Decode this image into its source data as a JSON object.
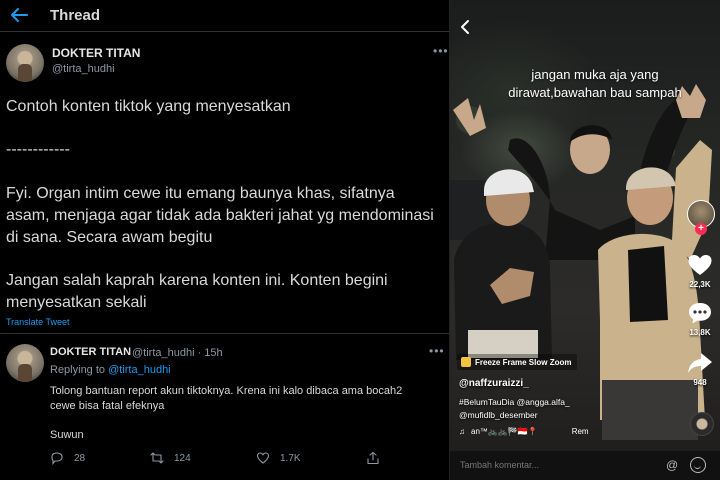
{
  "twitter": {
    "header_title": "Thread",
    "tweet1": {
      "name": "DOKTER TITAN",
      "handle": "@tirta_hudhi",
      "line1": "Contoh konten tiktok yang menyesatkan",
      "dashes": "------------",
      "para1": "Fyi. Organ intim cewe itu emang baunya khas, sifatnya asam,  menjaga agar tidak ada bakteri jahat yg mendominasi di sana. Secara awam begitu",
      "para2": "Jangan salah kaprah karena konten ini. Konten begini menyesatkan sekali",
      "translate": "Translate Tweet"
    },
    "tweet2": {
      "name": "DOKTER TITAN",
      "meta": "@tirta_hudhi · 15h",
      "replying_prefix": "Replying to ",
      "replying_handle": "@tirta_hudhi",
      "text": "Tolong bantuan report akun tiktoknya. Krena ini kalo dibaca ama bocah2 cewe bisa fatal efeknya",
      "closing": "Suwun",
      "replies": "28",
      "retweets": "124",
      "likes": "1.7K"
    }
  },
  "tiktok": {
    "caption": "jangan muka aja yang dirawat,bawahan bau sampah",
    "likes": "22,3K",
    "comments": "13,8K",
    "shares": "948",
    "effect": "Freeze Frame Slow Zoom",
    "username": "@naffzuraizzi_",
    "description": "#BelumTauDia @angga.alfa_ @mufidlb_desember",
    "music": "an™🚲🚲🏁🇮🇩📍",
    "music_right": "Rem",
    "comment_placeholder": "Tambah komentar..."
  },
  "icons": {
    "back": "arrow-left-icon",
    "more": "more-icon",
    "reply": "reply-icon",
    "retweet": "retweet-icon",
    "like": "heart-icon",
    "share": "share-icon"
  },
  "colors": {
    "twitter_link": "#1d9bf0",
    "tiktok_red": "#fe2c55",
    "background": "#000000"
  }
}
